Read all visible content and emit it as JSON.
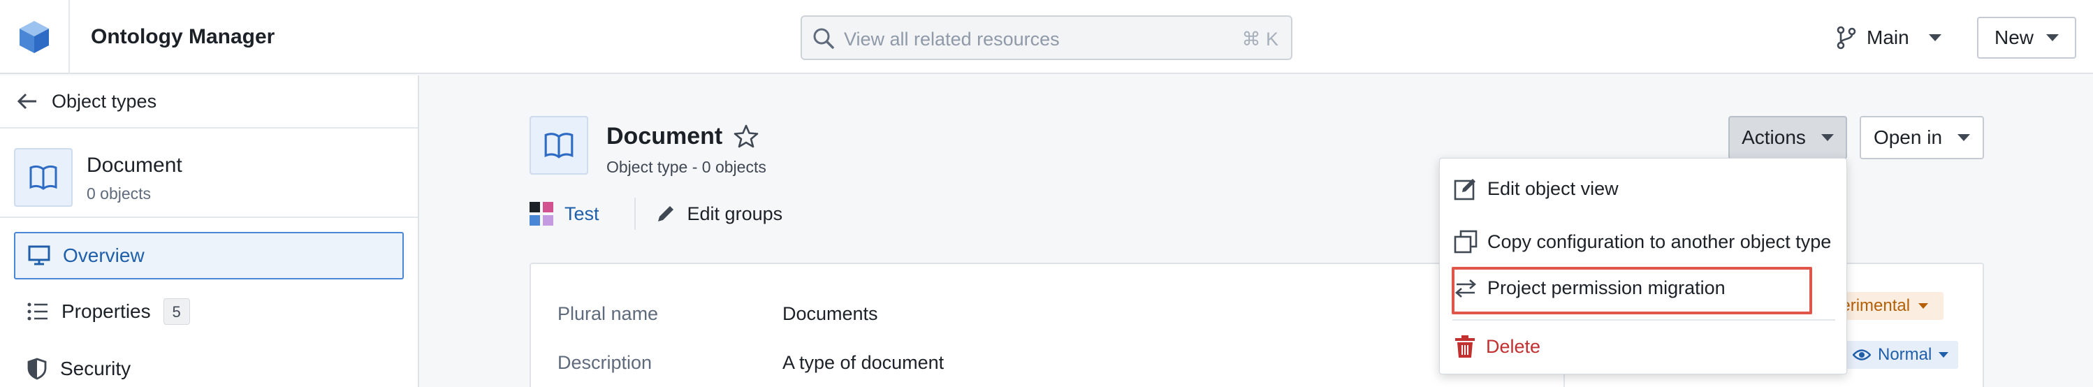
{
  "header": {
    "app_title": "Ontology Manager",
    "search_placeholder": "View all related resources",
    "search_shortcut": "⌘ K",
    "branch_label": "Main",
    "new_button": "New"
  },
  "sidebar": {
    "back_label": "Object types",
    "object": {
      "name": "Document",
      "count": "0 objects"
    },
    "nav": [
      {
        "label": "Overview",
        "active": true,
        "icon": "monitor-icon"
      },
      {
        "label": "Properties",
        "badge": "5",
        "icon": "list-icon"
      },
      {
        "label": "Security",
        "icon": "shield-icon"
      }
    ]
  },
  "main": {
    "title": "Document",
    "subtitle": "Object type - 0 objects",
    "group_label": "Test",
    "edit_groups_label": "Edit groups",
    "actions_button": "Actions",
    "open_in_button": "Open in",
    "properties": [
      {
        "label": "Plural name",
        "value": "Documents"
      },
      {
        "label": "Description",
        "value": "A type of document"
      }
    ],
    "status_tag": "perimental",
    "visibility_tag": "Normal"
  },
  "actions_menu": {
    "items": [
      {
        "label": "Edit object view",
        "icon": "edit-view-icon"
      },
      {
        "label": "Copy configuration to another object type",
        "icon": "copy-icon"
      },
      {
        "label": "Project permission migration",
        "icon": "swap-icon",
        "highlighted": true
      },
      {
        "label": "Delete",
        "icon": "trash-icon",
        "danger": true
      }
    ]
  },
  "colors": {
    "accent": "#1f5faa",
    "danger": "#c23030",
    "highlight_border": "#e0564b",
    "warning_tag": "#b45f06"
  }
}
